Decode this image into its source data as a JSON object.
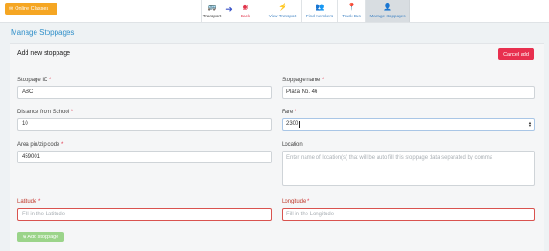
{
  "topbar": {
    "online_label": "Online Classes",
    "nav": {
      "transport": "Transport",
      "back": "Back",
      "view_transport": "View Transport",
      "find_members": "Find members",
      "track_bus": "Track Bus",
      "manage_stoppages": "Manage stoppages"
    }
  },
  "page_title": "Manage Stoppages",
  "form": {
    "title": "Add new stoppage",
    "cancel_label": "Cancel add",
    "stoppage_id": {
      "label": "Stoppage ID",
      "value": "ABC"
    },
    "stoppage_name": {
      "label": "Stoppage name",
      "value": "Plaza No. 46"
    },
    "distance": {
      "label": "Distance from School",
      "value": "10"
    },
    "fare": {
      "label": "Fare",
      "value": "2300"
    },
    "pin": {
      "label": "Area pin/zip code",
      "value": "459001"
    },
    "location": {
      "label": "Location",
      "placeholder": "Enter name of location(s) that will be auto fill this stoppage data separated by comma"
    },
    "latitude": {
      "label": "Latitude",
      "placeholder": "Fill in the Latitude"
    },
    "longitude": {
      "label": "Longitude",
      "placeholder": "Fill in the Longitude"
    },
    "add_label": "Add stoppage",
    "required_mark": "*"
  }
}
